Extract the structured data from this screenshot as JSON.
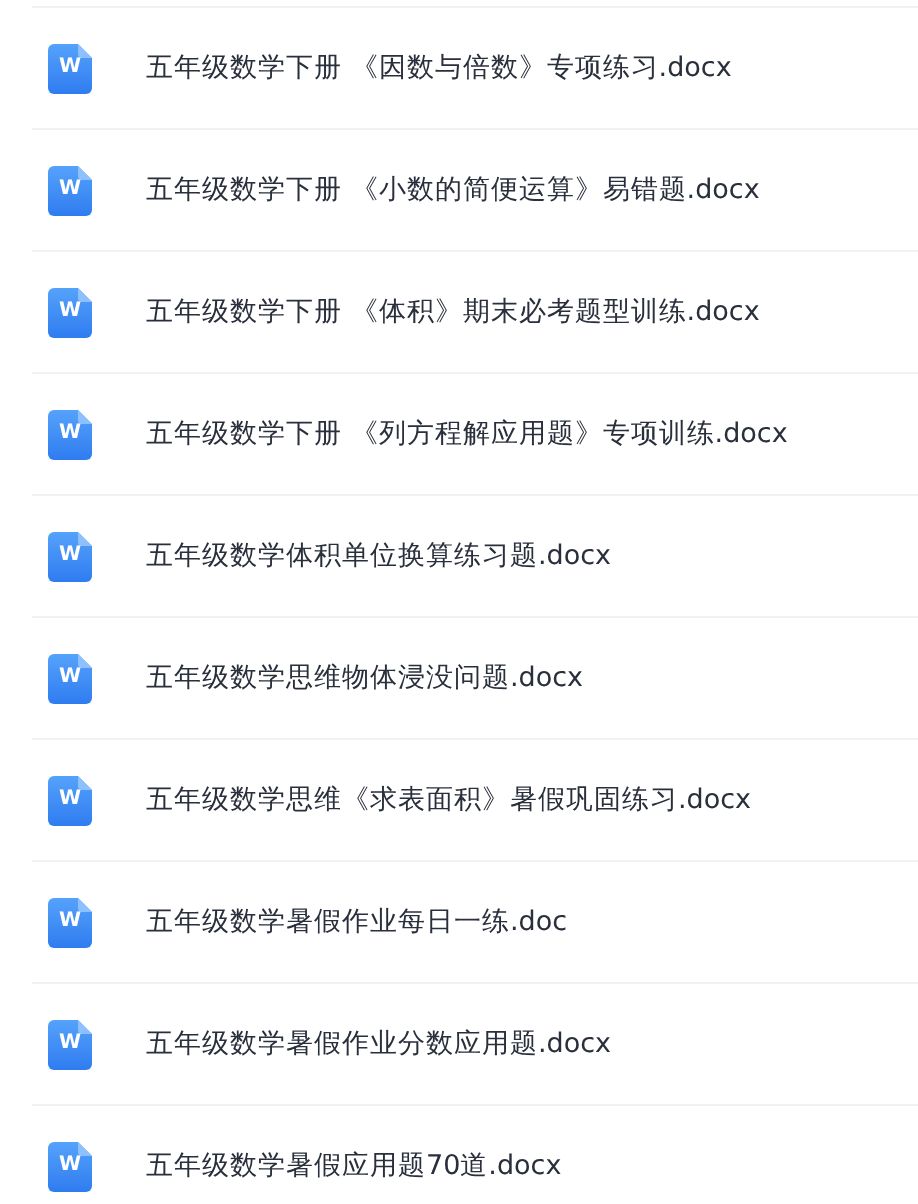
{
  "files": [
    {
      "icon_letter": "W",
      "name": "五年级数学下册 《因数与倍数》专项练习.docx"
    },
    {
      "icon_letter": "W",
      "name": "五年级数学下册 《小数的简便运算》易错题.docx"
    },
    {
      "icon_letter": "W",
      "name": "五年级数学下册 《体积》期末必考题型训练.docx"
    },
    {
      "icon_letter": "W",
      "name": "五年级数学下册 《列方程解应用题》专项训练.docx"
    },
    {
      "icon_letter": "W",
      "name": "五年级数学体积单位换算练习题.docx"
    },
    {
      "icon_letter": "W",
      "name": "五年级数学思维物体浸没问题.docx"
    },
    {
      "icon_letter": "W",
      "name": "五年级数学思维《求表面积》暑假巩固练习.docx"
    },
    {
      "icon_letter": "W",
      "name": "五年级数学暑假作业每日一练.doc"
    },
    {
      "icon_letter": "W",
      "name": "五年级数学暑假作业分数应用题.docx"
    },
    {
      "icon_letter": "W",
      "name": "五年级数学暑假应用题70道.docx"
    }
  ]
}
